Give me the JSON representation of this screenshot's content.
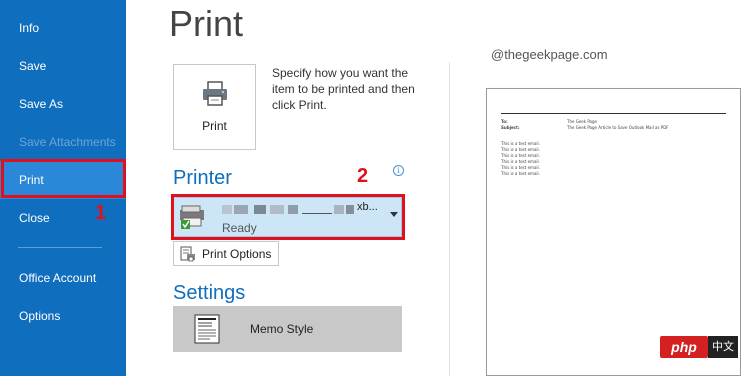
{
  "sidebar": {
    "items": [
      {
        "label": "Info"
      },
      {
        "label": "Save"
      },
      {
        "label": "Save As"
      },
      {
        "label": "Save Attachments"
      },
      {
        "label": "Print"
      },
      {
        "label": "Close"
      },
      {
        "label": "Office Account"
      },
      {
        "label": "Options"
      }
    ],
    "background": "#106ebe",
    "selected_color": "#2b88d8"
  },
  "annotations": {
    "step1": "1",
    "step2": "2",
    "color": "#e3101c"
  },
  "main": {
    "title": "Print",
    "print_button_label": "Print",
    "print_description": "Specify how you want the item to be printed and then click Print.",
    "printer_heading": "Printer",
    "printer": {
      "name_suffix": "xb...",
      "status": "Ready",
      "icon": "printer-icon"
    },
    "printer_info_glyph": "i",
    "print_options_label": "Print Options",
    "settings_heading": "Settings",
    "memo_style_label": "Memo Style",
    "accent_color": "#106ebe"
  },
  "watermark": "@thegeekpage.com",
  "preview": {
    "to_label": "To:",
    "to_value": "The Geek Page",
    "subject_label": "Subject:",
    "subject_value": "The Geek Page Article to Save Outlook Mail as PDF",
    "body_lines": [
      "This is a test email.",
      "This is a test email.",
      "This is a test email.",
      "This is a test email.",
      "This is a test email.",
      "This is a test email."
    ]
  },
  "badge": {
    "php": "php",
    "suffix": "中文网"
  }
}
